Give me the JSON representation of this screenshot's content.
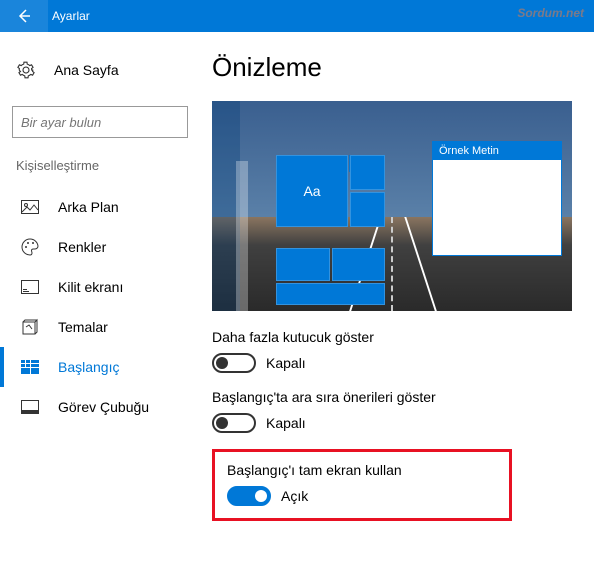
{
  "titlebar": {
    "title": "Ayarlar"
  },
  "watermark": "Sordum.net",
  "sidebar": {
    "home": "Ana Sayfa",
    "search_placeholder": "Bir ayar bulun",
    "category": "Kişiselleştirme",
    "items": [
      {
        "label": "Arka Plan"
      },
      {
        "label": "Renkler"
      },
      {
        "label": "Kilit ekranı"
      },
      {
        "label": "Temalar"
      },
      {
        "label": "Başlangıç"
      },
      {
        "label": "Görev Çubuğu"
      }
    ]
  },
  "main": {
    "title": "Önizleme",
    "preview": {
      "tile_text": "Aa",
      "sample_window_title": "Örnek Metin"
    },
    "settings": [
      {
        "label": "Daha fazla kutucuk göster",
        "state": "Kapalı",
        "on": false
      },
      {
        "label": "Başlangıç'ta ara sıra önerileri göster",
        "state": "Kapalı",
        "on": false
      },
      {
        "label": "Başlangıç'ı tam ekran kullan",
        "state": "Açık",
        "on": true,
        "highlighted": true
      }
    ]
  }
}
